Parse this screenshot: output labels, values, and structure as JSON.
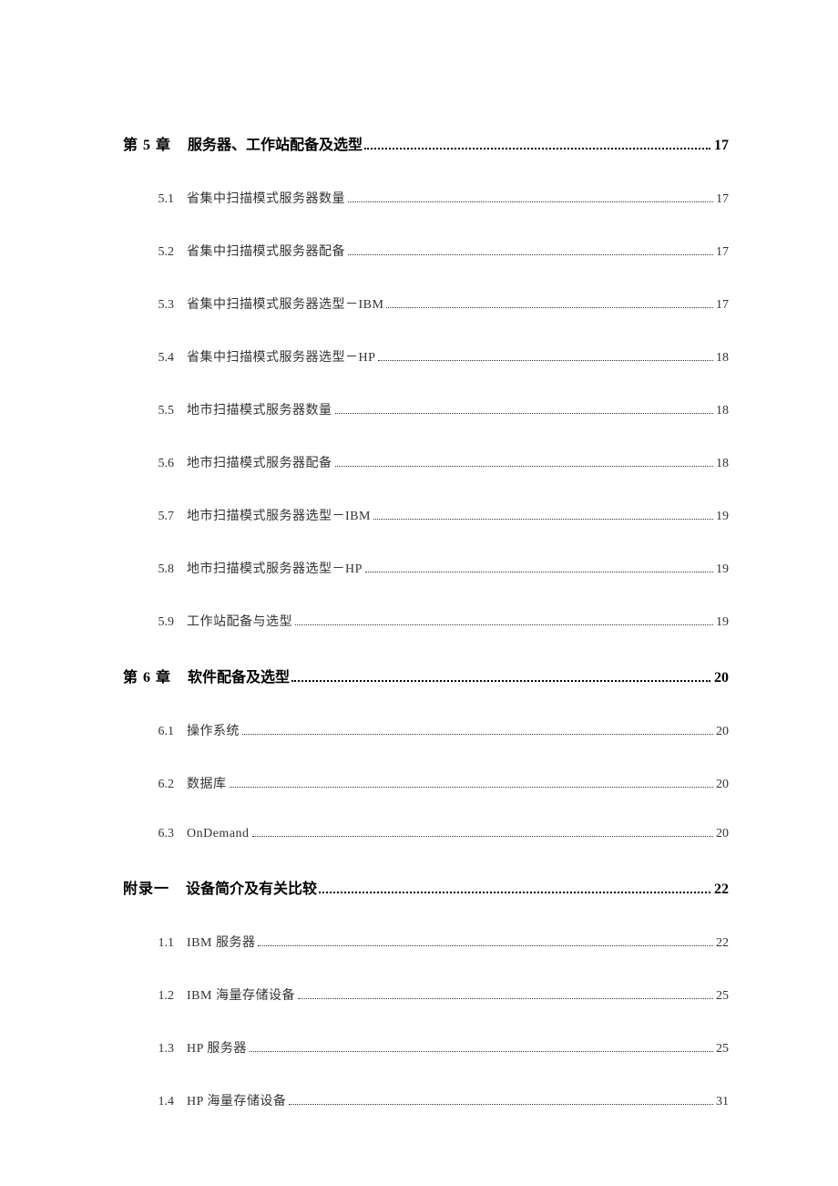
{
  "sections": [
    {
      "num": "第 5 章",
      "title": "服务器、工作站配备及选型",
      "page": "17",
      "subs": [
        {
          "num": "5.1",
          "title": "省集中扫描模式服务器数量",
          "page": "17"
        },
        {
          "num": "5.2",
          "title": "省集中扫描模式服务器配备",
          "page": "17"
        },
        {
          "num": "5.3",
          "title": "省集中扫描模式服务器选型－IBM",
          "page": "17"
        },
        {
          "num": "5.4",
          "title": "省集中扫描模式服务器选型－HP",
          "page": "18"
        },
        {
          "num": "5.5",
          "title": "地市扫描模式服务器数量",
          "page": "18"
        },
        {
          "num": "5.6",
          "title": "地市扫描模式服务器配备",
          "page": "18"
        },
        {
          "num": "5.7",
          "title": "地市扫描模式服务器选型－IBM",
          "page": "19"
        },
        {
          "num": "5.8",
          "title": "地市扫描模式服务器选型－HP",
          "page": "19"
        },
        {
          "num": "5.9",
          "title": "工作站配备与选型",
          "page": "19"
        }
      ]
    },
    {
      "num": "第 6 章",
      "title": "软件配备及选型",
      "page": "20",
      "subs": [
        {
          "num": "6.1",
          "title": "操作系统",
          "page": "20"
        },
        {
          "num": "6.2",
          "title": "数据库",
          "page": "20"
        },
        {
          "num": "6.3",
          "title": "OnDemand",
          "page": "20"
        }
      ]
    },
    {
      "num": "附录一",
      "title": "设备简介及有关比较",
      "page": "22",
      "subs": [
        {
          "num": "1.1",
          "title": "IBM 服务器",
          "page": "22"
        },
        {
          "num": "1.2",
          "title": "IBM 海量存储设备",
          "page": "25"
        },
        {
          "num": "1.3",
          "title": "HP 服务器",
          "page": "25"
        },
        {
          "num": "1.4",
          "title": "HP 海量存储设备",
          "page": "31"
        }
      ]
    }
  ]
}
